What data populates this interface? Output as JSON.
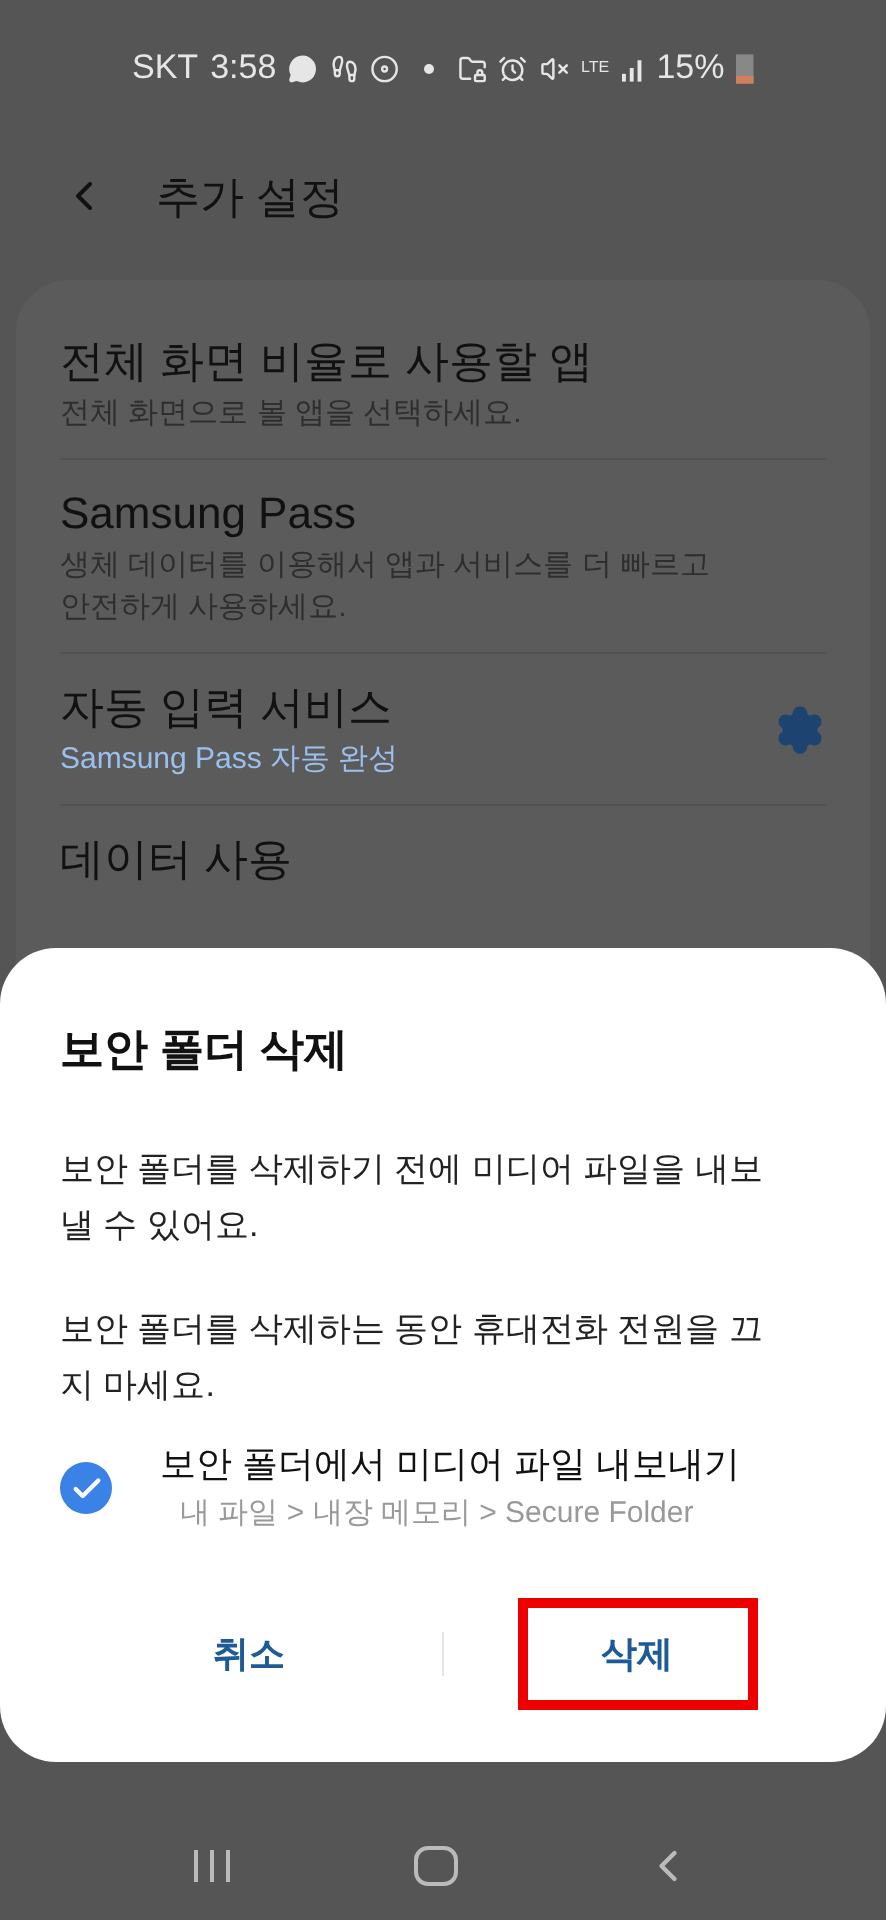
{
  "status_bar": {
    "carrier": "SKT",
    "time": "3:58",
    "network": "LTE",
    "battery": "15%"
  },
  "header": {
    "title": "추가 설정"
  },
  "settings": [
    {
      "kind": "plain",
      "title": "전체 화면 비율로 사용할 앱",
      "subtitle": "전체 화면으로 볼 앱을 선택하세요."
    },
    {
      "kind": "plain",
      "title": "Samsung Pass",
      "subtitle": "생체 데이터를 이용해서 앱과 서비스를 더 빠르고 안전하게 사용하세요."
    },
    {
      "kind": "gear",
      "title": "자동 입력 서비스",
      "subtitle": "Samsung Pass 자동 완성"
    },
    {
      "kind": "plain",
      "title": "데이터 사용"
    }
  ],
  "dialog": {
    "title": "보안 폴더 삭제",
    "paragraphs": [
      "보안 폴더를 삭제하기 전에 미디어 파일을 내보낼 수 있어요.",
      "보안 폴더를 삭제하는 동안 휴대전화 전원을 끄지 마세요."
    ],
    "option": {
      "label": "보안 폴더에서 미디어 파일 내보내기",
      "path": "내 파일 > 내장 메모리 > Secure Folder",
      "checked": true
    },
    "buttons": [
      {
        "label": "취소",
        "highlighted": false
      },
      {
        "label": "삭제",
        "highlighted": true
      }
    ]
  }
}
